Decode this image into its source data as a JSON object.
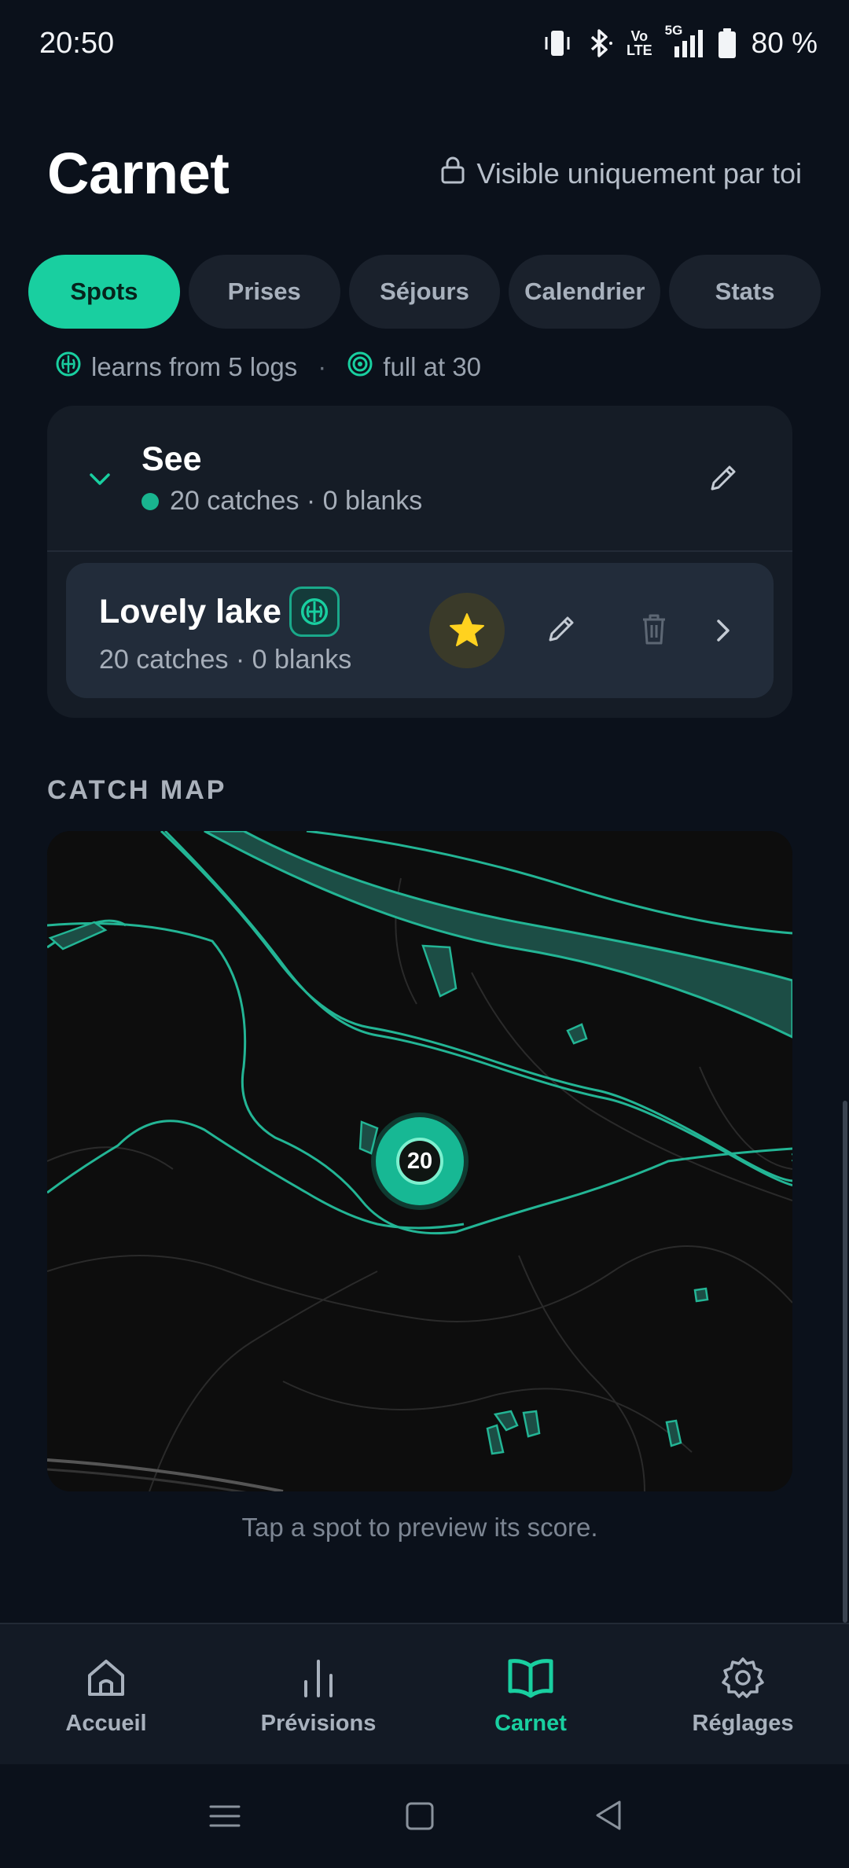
{
  "status_bar": {
    "time": "20:50",
    "network_label": "5G",
    "volte_label_top": "Vo",
    "volte_label_bottom": "LTE",
    "battery_text": "80 %",
    "icons": [
      "vibrate-icon",
      "bluetooth-icon",
      "volte-icon",
      "signal-5g-icon",
      "battery-icon"
    ]
  },
  "header": {
    "title": "Carnet",
    "privacy_note": "Visible uniquement par toi",
    "privacy_icon": "lock-icon"
  },
  "tabs": [
    {
      "label": "Spots",
      "active": true
    },
    {
      "label": "Prises",
      "active": false
    },
    {
      "label": "Séjours",
      "active": false
    },
    {
      "label": "Calendrier",
      "active": false
    },
    {
      "label": "Stats",
      "active": false
    }
  ],
  "info_line": {
    "learn_text": "learns from 5 logs",
    "separator": "·",
    "full_text": "full at 30"
  },
  "spot_group": {
    "title": "See",
    "meta": "20 catches · 0 blanks",
    "expanded": true
  },
  "spot": {
    "title": "Lovely lake",
    "meta": "20 catches · 0 blanks",
    "favorite": true
  },
  "map": {
    "heading": "CATCH MAP",
    "cluster_count": "20",
    "hint": "Tap a spot to preview its score."
  },
  "bottom_nav": [
    {
      "label": "Accueil",
      "icon": "home-icon",
      "active": false
    },
    {
      "label": "Prévisions",
      "icon": "bar-chart-icon",
      "active": false
    },
    {
      "label": "Carnet",
      "icon": "book-icon",
      "active": true
    },
    {
      "label": "Réglages",
      "icon": "gear-icon",
      "active": false
    }
  ],
  "colors": {
    "accent": "#19cfa0",
    "background": "#0b111b",
    "card": "#151c26",
    "favorite_star": "#ffd21f"
  }
}
